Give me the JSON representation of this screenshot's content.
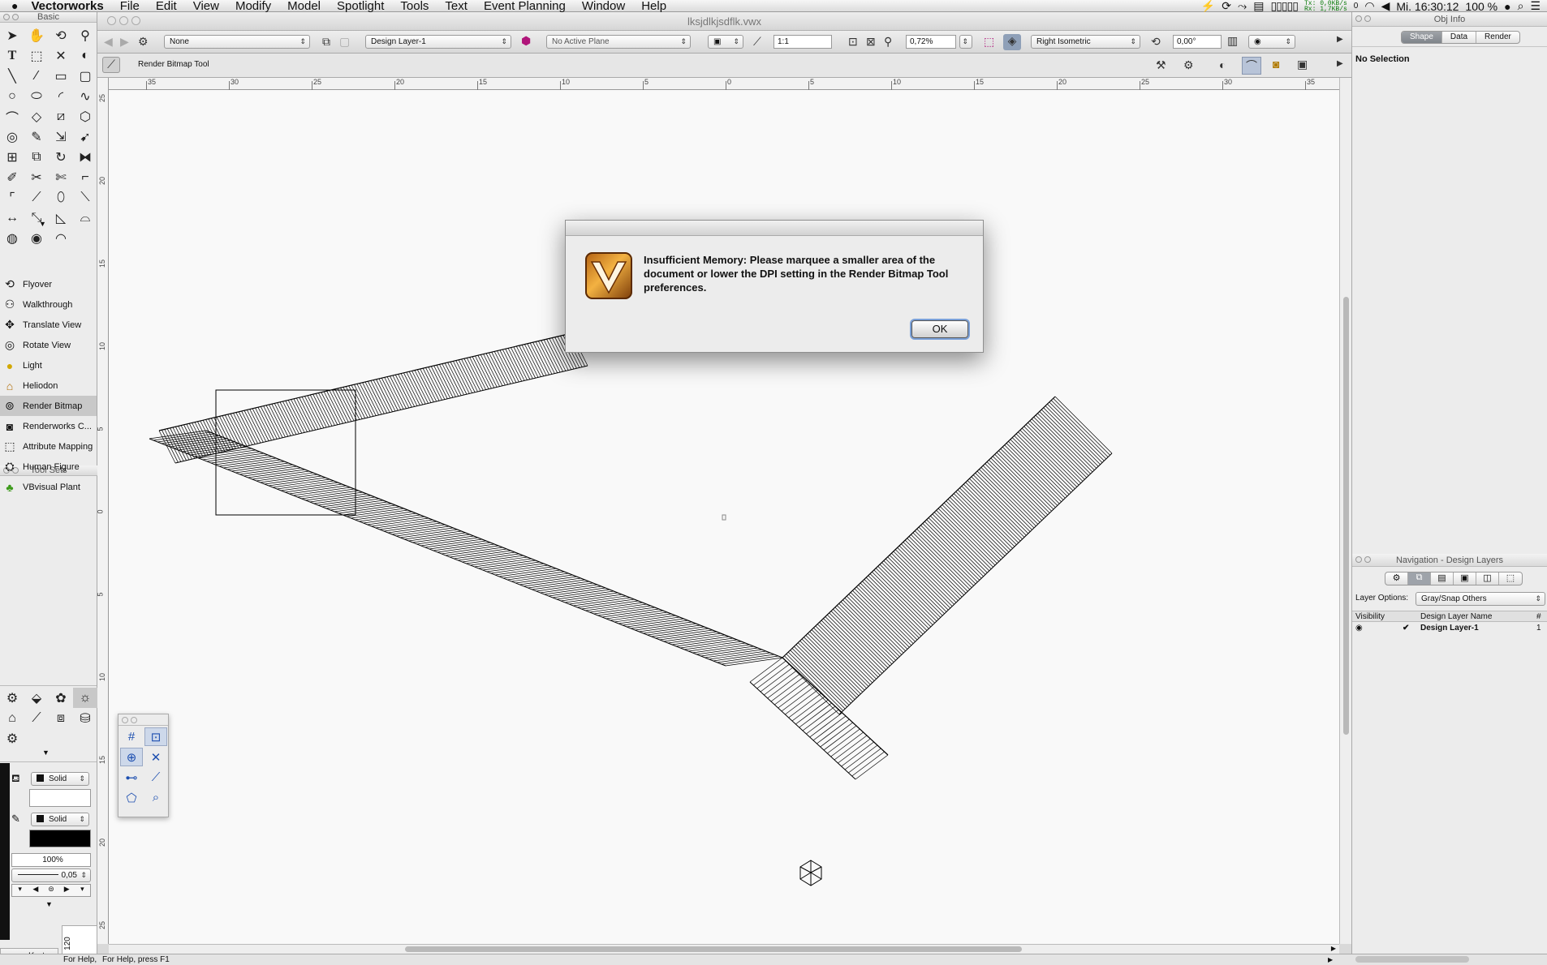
{
  "menubar": {
    "app_name": "Vectorworks",
    "items": [
      "File",
      "Edit",
      "View",
      "Modify",
      "Model",
      "Spotlight",
      "Tools",
      "Text",
      "Event Planning",
      "Window",
      "Help"
    ],
    "net_tx": "0,0KB/s",
    "net_rx": "1,7KB/s",
    "tx_label": "Tx:",
    "rx_label": "Rx:",
    "counter": "0",
    "clock": "Mi. 16:30:12",
    "battery": "100 %"
  },
  "document": {
    "title": "lksjdlkjsdflk.vwx"
  },
  "palettes": {
    "basic_title": "Basic",
    "toolsets_title": "Tool Sets",
    "toolset_items": [
      {
        "label": "Flyover",
        "icon": "flyover-icon"
      },
      {
        "label": "Walkthrough",
        "icon": "walkthrough-icon"
      },
      {
        "label": "Translate View",
        "icon": "translate-view-icon"
      },
      {
        "label": "Rotate View",
        "icon": "rotate-view-icon"
      },
      {
        "label": "Light",
        "icon": "light-icon"
      },
      {
        "label": "Heliodon",
        "icon": "heliodon-icon"
      },
      {
        "label": "Render Bitmap",
        "icon": "render-bitmap-icon",
        "selected": true
      },
      {
        "label": "Renderworks C...",
        "icon": "renderworks-camera-icon"
      },
      {
        "label": "Attribute Mapping",
        "icon": "attribute-mapping-icon"
      },
      {
        "label": "Human Figure",
        "icon": "human-figure-icon"
      },
      {
        "label": "VBvisual Plant",
        "icon": "plant-icon"
      }
    ],
    "fill_style": "Solid",
    "pen_style": "Solid",
    "opacity": "100%",
    "line_weight": "0,05",
    "scale_label": "120",
    "bottom_tab": "Karte"
  },
  "toolbar": {
    "class": "None",
    "layer": "Design Layer-1",
    "plane": "No Active Plane",
    "scale": "1:1",
    "zoom": "0,72%",
    "view": "Right Isometric",
    "angle": "0,00°",
    "mode_label": "Render Bitmap Tool"
  },
  "rulers": {
    "h_ticks": [
      "35",
      "30",
      "25",
      "20",
      "15",
      "10",
      "5",
      "0",
      "5",
      "10",
      "15",
      "20",
      "25",
      "30",
      "35"
    ],
    "v_ticks": [
      "25",
      "20",
      "15",
      "10",
      "5",
      "0",
      "5",
      "10",
      "15",
      "20",
      "25"
    ]
  },
  "objinfo": {
    "title": "Obj Info",
    "tabs": [
      "Shape",
      "Data",
      "Render"
    ],
    "active_tab": "Shape",
    "selection": "No Selection"
  },
  "navigation": {
    "title": "Navigation - Design Layers",
    "layer_options_label": "Layer Options:",
    "layer_options_value": "Gray/Snap Others",
    "col_visibility": "Visibility",
    "col_name": "Design Layer Name",
    "col_num": "#",
    "rows": [
      {
        "name": "Design Layer-1",
        "num": "1",
        "active": true
      }
    ]
  },
  "dialog": {
    "message": "Insufficient Memory: Please marquee a smaller area of the document or lower the DPI setting in the Render Bitmap Tool preferences.",
    "ok_label": "OK"
  },
  "status": {
    "help_left": "For Help,",
    "help_main": "For Help, press F1"
  }
}
